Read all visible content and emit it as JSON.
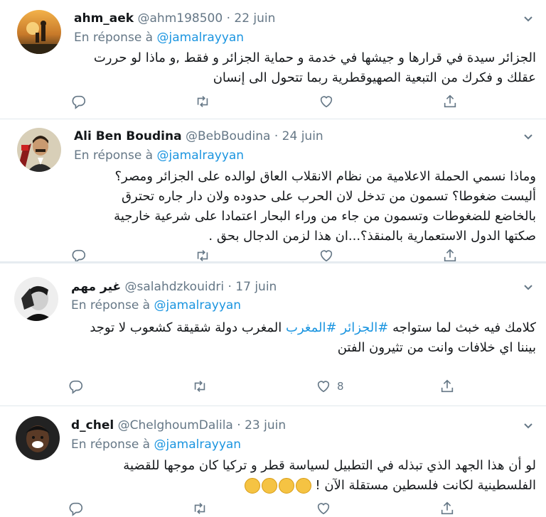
{
  "tweets": [
    {
      "name": "ahm_aek",
      "handle": "@ahm198500",
      "dot": "·",
      "date": "22 juin",
      "reply_prefix": "En réponse à",
      "reply_to": "@jamalrayyan",
      "lines": [
        "الجزائر سيدة في قرارها و جيشها في خدمة و حماية الجزائر و فقط ,و ماذا لو حررت",
        "عقلك و فكرك من التبعية الصهيوقطرية ربما تتحول الى إنسان"
      ],
      "likes": ""
    },
    {
      "name": "Ali Ben Boudina",
      "handle": "@BebBoudina",
      "dot": "·",
      "date": "24 juin",
      "reply_prefix": "En réponse à",
      "reply_to": "@jamalrayyan",
      "lines": [
        "وماذا نسمي الحملة الاعلامية من نظام الانقلاب العاق لوالده على الجزائر ومصر؟",
        "أليست ضغوطا؟ تسمون من تدخل لان الحرب على حدوده ولان دار جاره تحترق",
        "بالخاضع للضغوطات وتسمون من جاء من وراء البحار اعتمادا على شرعية خارجية",
        "صكتها الدول الاستعمارية بالمنقذ؟...ان هذا لزمن الدجال بحق ."
      ],
      "likes": ""
    },
    {
      "name": "غير مهم",
      "handle": "@salahdzkouidri",
      "dot": "·",
      "date": "17 juin",
      "reply_prefix": "En réponse à",
      "reply_to": "@jamalrayyan",
      "line1_pre": "كلامك فيه خبث لما ستواجه ",
      "tag1": "#الجزائر",
      "tag2": "#المغرب",
      "line1_post": " المغرب دولة شقيقة كشعوب لا توجد",
      "line2": "بيننا اي خلافات وانت من تثيرون الفتن",
      "likes": "8"
    },
    {
      "name": "d_chel",
      "handle": "@ChelghoumDalila",
      "dot": "·",
      "date": "23 juin",
      "reply_prefix": "En réponse à",
      "reply_to": "@jamalrayyan",
      "lines": [
        "لو أن هذا الجهد الذي تبذله في التطبيل لسياسة قطر و تركيا كان موجها للقضية",
        "الفلسطينية لكانت فلسطين مستقلة الآن !"
      ],
      "likes": ""
    }
  ],
  "icons": {
    "reply": "reply-icon",
    "retweet": "retweet-icon",
    "like": "heart-icon",
    "share": "share-icon",
    "caret": "chevron-down-icon"
  },
  "colors": {
    "link": "#1b95e0",
    "muted": "#657786",
    "text": "#14171a",
    "separator": "#e6ecf0"
  }
}
